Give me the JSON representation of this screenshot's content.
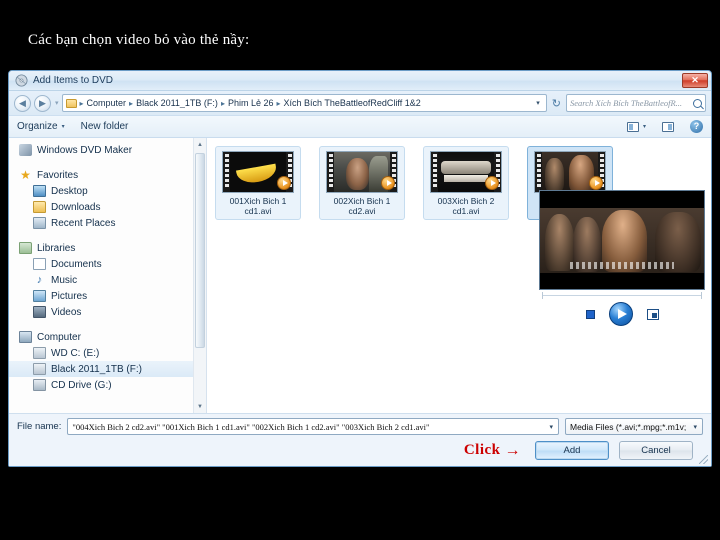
{
  "slide": {
    "heading": "Các bạn chọn video bỏ vào thẻ nầy:"
  },
  "dialog": {
    "title": "Add Items to DVD",
    "title_icon": "dvd-maker-icon",
    "close_label": "✕",
    "nav": {
      "back_label": "◀",
      "forward_label": "▶",
      "history_caret": "▾",
      "breadcrumbs": [
        "Computer",
        "Black 2011_1TB (F:)",
        "Phim Lẻ 26",
        "Xích Bích TheBattleofRedCliff 1&2"
      ],
      "separator": "▸",
      "address_caret": "▾",
      "refresh_label": "↻"
    },
    "search": {
      "placeholder": "Search Xích Bích TheBattleofR...",
      "icon": "search-icon"
    },
    "toolbar": {
      "organize_label": "Organize",
      "organize_caret": "▾",
      "new_folder_label": "New folder",
      "view_caret": "▾",
      "help_label": "?"
    },
    "sidebar": {
      "app_label": "Windows DVD Maker",
      "groups": [
        {
          "label": "Favorites",
          "icon": "star-icon",
          "items": [
            {
              "label": "Desktop",
              "icon": "desktop-icon"
            },
            {
              "label": "Downloads",
              "icon": "downloads-icon"
            },
            {
              "label": "Recent Places",
              "icon": "recent-places-icon"
            }
          ]
        },
        {
          "label": "Libraries",
          "icon": "libraries-icon",
          "items": [
            {
              "label": "Documents",
              "icon": "documents-icon"
            },
            {
              "label": "Music",
              "icon": "music-icon"
            },
            {
              "label": "Pictures",
              "icon": "pictures-icon"
            },
            {
              "label": "Videos",
              "icon": "videos-icon"
            }
          ]
        },
        {
          "label": "Computer",
          "icon": "computer-icon",
          "items": [
            {
              "label": "WD C: (E:)",
              "icon": "drive-icon",
              "selected": false
            },
            {
              "label": "Black 2011_1TB (F:)",
              "icon": "drive-icon",
              "selected": true
            },
            {
              "label": "CD Drive (G:)",
              "icon": "cd-drive-icon",
              "selected": false
            }
          ]
        }
      ],
      "scroll_up": "▲",
      "scroll_down": "▼"
    },
    "files": [
      {
        "name": "001Xich Bich 1 cd1.avi",
        "scene": "banana",
        "selected": false
      },
      {
        "name": "002Xich Bich 1 cd2.avi",
        "scene": "woman",
        "selected": false
      },
      {
        "name": "003Xich Bich 2 cd1.avi",
        "scene": "boat",
        "selected": false
      },
      {
        "name": "004Xich Bich 2 cd2.avi",
        "scene": "men",
        "selected": true
      }
    ],
    "preview": {
      "stop_icon": "stop-icon",
      "play_icon": "play-icon",
      "fullscreen_icon": "fullscreen-icon"
    },
    "footer": {
      "filename_label": "File name:",
      "filename_value": "\"004Xich Bich 2 cd2.avi\" \"001Xich Bich 1 cd1.avi\" \"002Xich Bich 1 cd2.avi\" \"003Xich Bich 2 cd1.avi\"",
      "filename_caret": "▾",
      "filetype_value": "Media Files (*.avi;*.mpg;*.m1v;",
      "filetype_caret": "▾",
      "add_label": "Add",
      "cancel_label": "Cancel"
    }
  },
  "annotation": {
    "click_text": "Click",
    "arrow": "→",
    "color": "#cc0000"
  }
}
